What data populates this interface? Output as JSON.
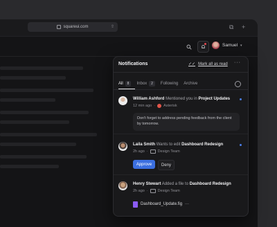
{
  "browser": {
    "url": "squareui.com"
  },
  "appbar": {
    "user_name": "Samuel"
  },
  "panel": {
    "title": "Notifications",
    "mark_all": "Mark all as read",
    "tabs": [
      {
        "label": "All",
        "count": "8"
      },
      {
        "label": "Inbox",
        "count": "2"
      },
      {
        "label": "Following",
        "count": ""
      },
      {
        "label": "Archive",
        "count": ""
      }
    ],
    "items": [
      {
        "name": "William Ashford",
        "action": "Mentioned you in",
        "target": "Project Updates",
        "time": "12 min ago",
        "tag": "Asterisk",
        "quote": "Don't forget to address pending feedback from the client by tomorrow."
      },
      {
        "name": "Laila Smith",
        "action": "Wants to edit",
        "target": "Dashboard Redesign",
        "time": "2h ago",
        "tag": "Design Team",
        "approve": "Approve",
        "deny": "Deny"
      },
      {
        "name": "Henry Stewart",
        "action": "Added a file to",
        "target": "Dashboard Redesign",
        "time": "2h ago",
        "tag": "Design Team",
        "file": "Dashboard_Update.fig"
      }
    ]
  }
}
